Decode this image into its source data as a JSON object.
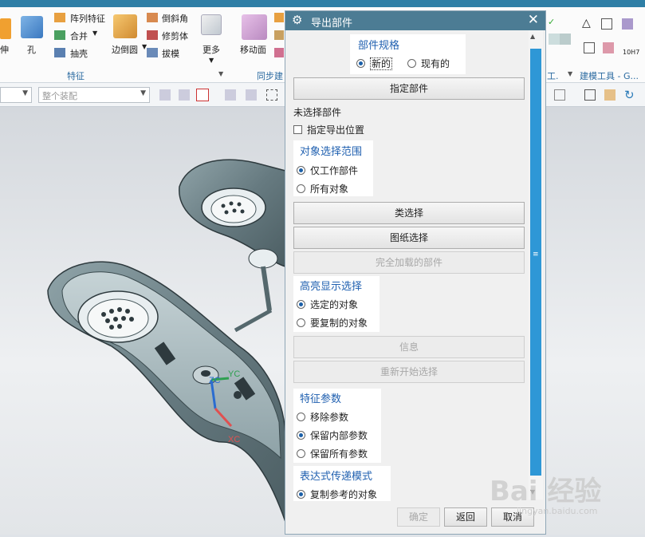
{
  "ribbon": {
    "items": {
      "stretch": "伸",
      "hole": "孔",
      "pattern": "阵列特征",
      "unite": "合并",
      "shell": "抽壳",
      "edge_blend": "边倒圆",
      "chamfer": "倒斜角",
      "trim_body": "修剪体",
      "draft": "拔模",
      "more": "更多",
      "move_face": "移动面",
      "modeling_tools": "建模工具 - G..."
    },
    "groups": {
      "feature": "特征",
      "sync": "同步建",
      "gong": "工."
    },
    "icons": {
      "triangle": "△",
      "tenh7": "10H7"
    }
  },
  "toolbar": {
    "selection_filter": "整个装配"
  },
  "viewport": {
    "axes": {
      "zc": "ZC",
      "yc": "YC",
      "xc": "XC"
    }
  },
  "dialog": {
    "title": "导出部件",
    "part_spec": {
      "title": "部件规格",
      "options": [
        "新的",
        "现有的"
      ],
      "selected": "新的"
    },
    "specify_part_button": "指定部件",
    "status": "未选择部件",
    "specify_export_location": "指定导出位置",
    "scope": {
      "title": "对象选择范围",
      "options": [
        "仅工作部件",
        "所有对象"
      ],
      "selected": "仅工作部件"
    },
    "class_select_button": "类选择",
    "drawing_select_button": "图纸选择",
    "fully_loaded_button": "完全加载的部件",
    "highlight": {
      "title": "高亮显示选择",
      "options": [
        "选定的对象",
        "要复制的对象"
      ],
      "selected": "选定的对象"
    },
    "info_button": "信息",
    "restart_button": "重新开始选择",
    "feature_params": {
      "title": "特征参数",
      "options": [
        "移除参数",
        "保留内部参数",
        "保留所有参数"
      ],
      "selected": "保留内部参数"
    },
    "expression_mode": {
      "title": "表达式传递模式",
      "options": [
        "复制参考的对象"
      ],
      "selected": "复制参考的对象"
    },
    "ok_button": "确定",
    "back_button": "返回",
    "cancel_button": "取消"
  },
  "watermark": {
    "brand": "Bai 经验",
    "url": "jingyan.baidu.com"
  }
}
